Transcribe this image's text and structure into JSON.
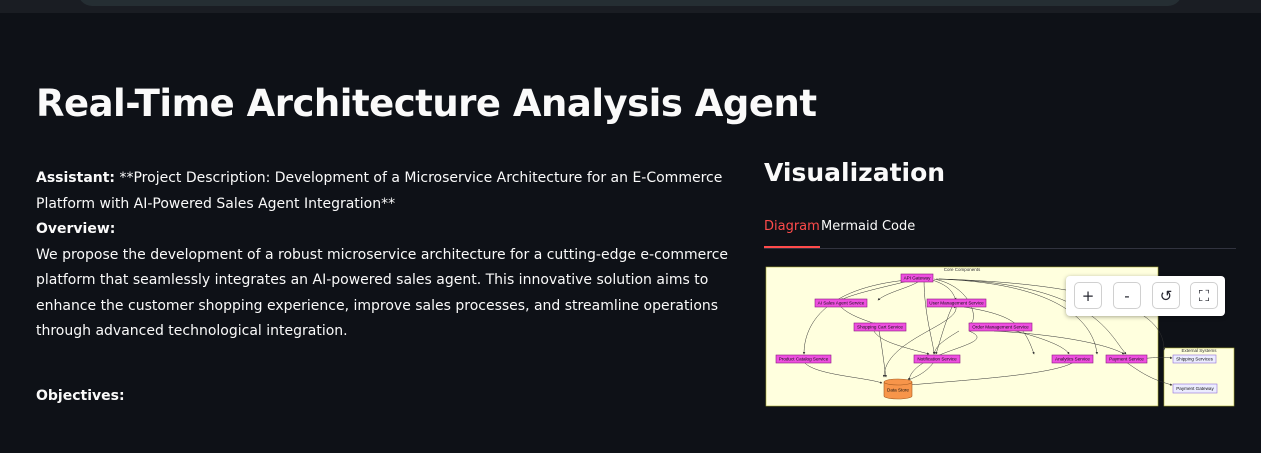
{
  "page_title": "Real-Time Architecture Analysis Agent",
  "chat": {
    "assistant_label": "Assistant:",
    "line1": " **Project Description: Development of a Microservice Architecture for an E-Commerce Platform with AI-Powered Sales Agent Integration**",
    "overview_heading": "Overview:",
    "overview_text": "We propose the development of a robust microservice architecture for a cutting-edge e-commerce platform that seamlessly integrates an AI-powered sales agent. This innovative solution aims to enhance the customer shopping experience, improve sales processes, and streamline operations through advanced technological integration.",
    "objectives_heading": "Objectives:"
  },
  "visualization": {
    "title": "Visualization",
    "tabs": [
      {
        "label": "Diagram",
        "active": true
      },
      {
        "label": "Mermaid Code",
        "active": false
      }
    ],
    "zoom_controls": {
      "zoom_in_icon": "plus-icon",
      "zoom_in_label": "+",
      "zoom_out_icon": "minus-icon",
      "zoom_out_label": "-",
      "reset_icon": "reset-icon",
      "reset_label": "↺",
      "fullscreen_icon": "fullscreen-icon",
      "fullscreen_label": "⛶"
    }
  },
  "diagram": {
    "core_group_label": "Core Components",
    "external_group_label": "External Systems",
    "nodes": {
      "api_gateway": "API Gateway",
      "ai_sales_agent": "AI Sales Agent Service",
      "user_management": "User Management Service",
      "shopping_cart": "Shopping Cart Service",
      "order_management": "Order Management Service",
      "product_catalog": "Product Catalog Service",
      "notification": "Notification Service",
      "analytics": "Analytics Service",
      "payment": "Payment Service",
      "data_store": "Data Store",
      "shipping": "Shipping Services",
      "payment_gateway": "Payment Gateway"
    }
  },
  "colors": {
    "background": "#0e1117",
    "accent": "#ff4b4b",
    "node_fill": "#ee4fe0",
    "cluster_fill": "#ffffde",
    "external_node_fill": "#ececff",
    "datastore_fill": "#f7954a"
  }
}
